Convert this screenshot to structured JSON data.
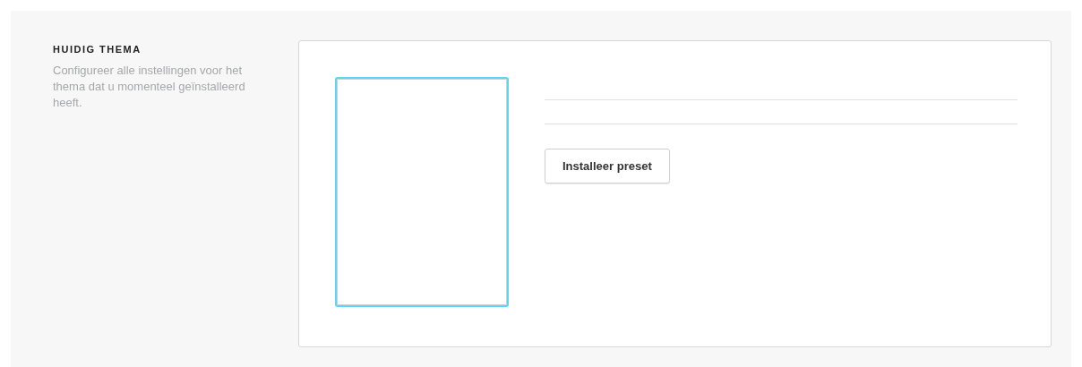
{
  "section": {
    "title": "HUIDIG THEMA",
    "description": "Configureer alle instellingen voor het thema dat u momenteel geïnstalleerd heeft."
  },
  "theme_preview": {
    "selected": true
  },
  "buttons": [
    "Installeer preset"
  ]
}
